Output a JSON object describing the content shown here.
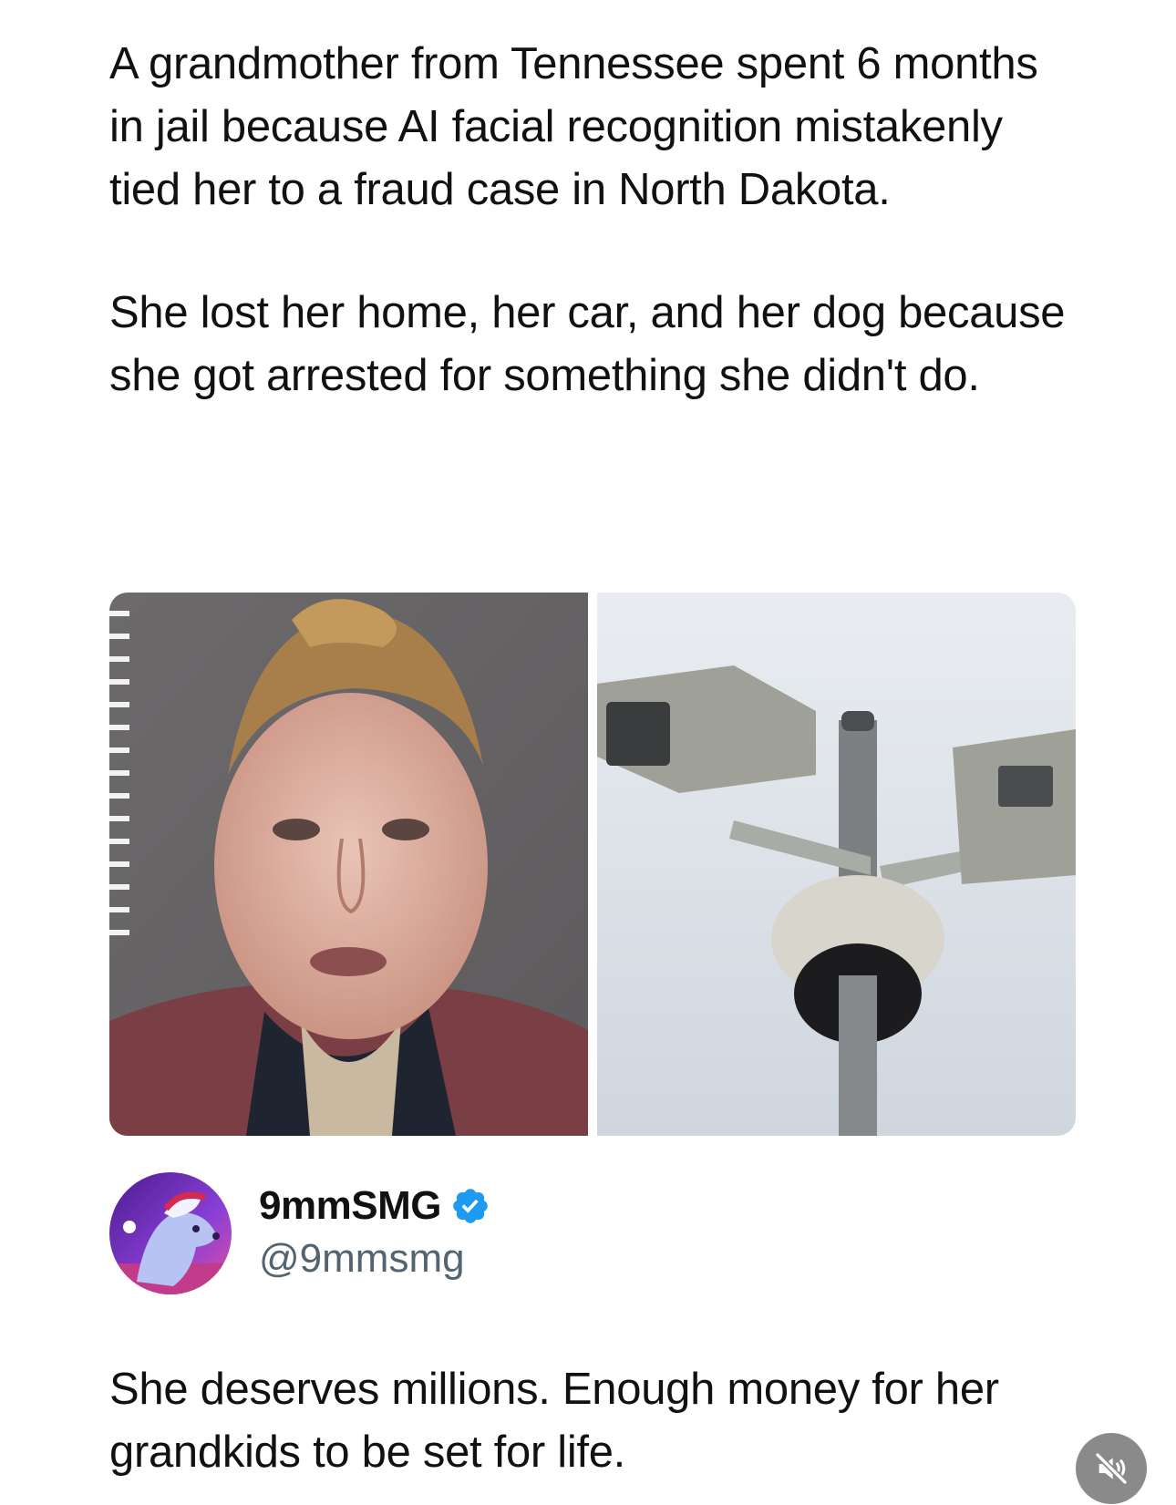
{
  "post": {
    "paragraphs": [
      "A grandmother from Tennessee spent 6 months in jail because AI facial recognition mistakenly tied her to a fraud case in North Dakota.",
      "She lost her home, her car, and her dog because she got arrested for something she didn't do."
    ],
    "media": [
      {
        "icon": "mugshot-photo"
      },
      {
        "icon": "surveillance-cameras-photo"
      }
    ]
  },
  "author": {
    "display_name": "9mmSMG",
    "handle": "@9mmsmg",
    "verified": true,
    "verified_color": "#1d9bf0",
    "avatar_icon": "dog-avatar-icon"
  },
  "comment": {
    "text": "She deserves millions. Enough money for her grandkids to be set for life."
  },
  "controls": {
    "mute_icon": "speaker-muted-icon"
  }
}
